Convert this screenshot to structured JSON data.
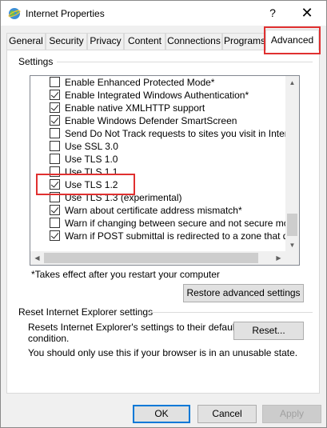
{
  "window": {
    "title": "Internet Properties",
    "help_glyph": "?",
    "close_glyph": "✕"
  },
  "tabs": [
    {
      "label": "General",
      "active": false
    },
    {
      "label": "Security",
      "active": false
    },
    {
      "label": "Privacy",
      "active": false
    },
    {
      "label": "Content",
      "active": false
    },
    {
      "label": "Connections",
      "active": false
    },
    {
      "label": "Programs",
      "active": false
    },
    {
      "label": "Advanced",
      "active": true
    }
  ],
  "settings": {
    "group_label": "Settings",
    "items": [
      {
        "label": "Enable Enhanced Protected Mode*",
        "checked": false
      },
      {
        "label": "Enable Integrated Windows Authentication*",
        "checked": true
      },
      {
        "label": "Enable native XMLHTTP support",
        "checked": true
      },
      {
        "label": "Enable Windows Defender SmartScreen",
        "checked": true
      },
      {
        "label": "Send Do Not Track requests to sites you visit in Internet E",
        "checked": false
      },
      {
        "label": "Use SSL 3.0",
        "checked": false
      },
      {
        "label": "Use TLS 1.0",
        "checked": false
      },
      {
        "label": "Use TLS 1.1",
        "checked": false
      },
      {
        "label": "Use TLS 1.2",
        "checked": true
      },
      {
        "label": "Use TLS 1.3 (experimental)",
        "checked": false
      },
      {
        "label": "Warn about certificate address mismatch*",
        "checked": true
      },
      {
        "label": "Warn if changing between secure and not secure mode",
        "checked": false
      },
      {
        "label": "Warn if POST submittal is redirected to a zone that does n",
        "checked": true
      }
    ],
    "footnote": "*Takes effect after you restart your computer",
    "restore_button": "Restore advanced settings"
  },
  "reset": {
    "group_label": "Reset Internet Explorer settings",
    "description_line1": "Resets Internet Explorer's settings to their default",
    "description_line2": "condition.",
    "reset_button": "Reset...",
    "warning": "You should only use this if your browser is in an unusable state."
  },
  "footer": {
    "ok": "OK",
    "cancel": "Cancel",
    "apply": "Apply"
  },
  "colors": {
    "highlight_box": "#e03030",
    "default_button_border": "#0078d7"
  }
}
